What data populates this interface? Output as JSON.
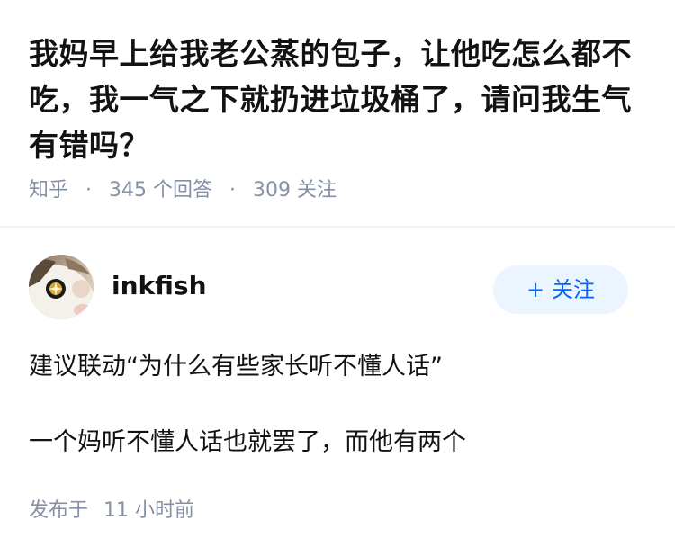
{
  "question": {
    "title": "我妈早上给我老公蒸的包子，让他吃怎么都不吃，我一气之下就扔进垃圾桶了，请问我生气有错吗？",
    "source": "知乎",
    "separator": "·",
    "answers_count": "345",
    "answers_label": "个回答",
    "followers_count": "309",
    "followers_label": "关注"
  },
  "answer": {
    "author_name": "inkfish",
    "follow_plus": "+",
    "follow_label": "关注",
    "paragraphs": [
      "建议联动“为什么有些家长听不懂人话”",
      "一个妈听不懂人话也就罢了，而他有两个"
    ],
    "published_label": "发布于",
    "published_time": "11 小时前"
  },
  "colors": {
    "text": "#121212",
    "meta": "#8590a6",
    "accent": "#0066ff",
    "follow_bg": "#ebf5ff",
    "divider": "#f3f3f3"
  }
}
